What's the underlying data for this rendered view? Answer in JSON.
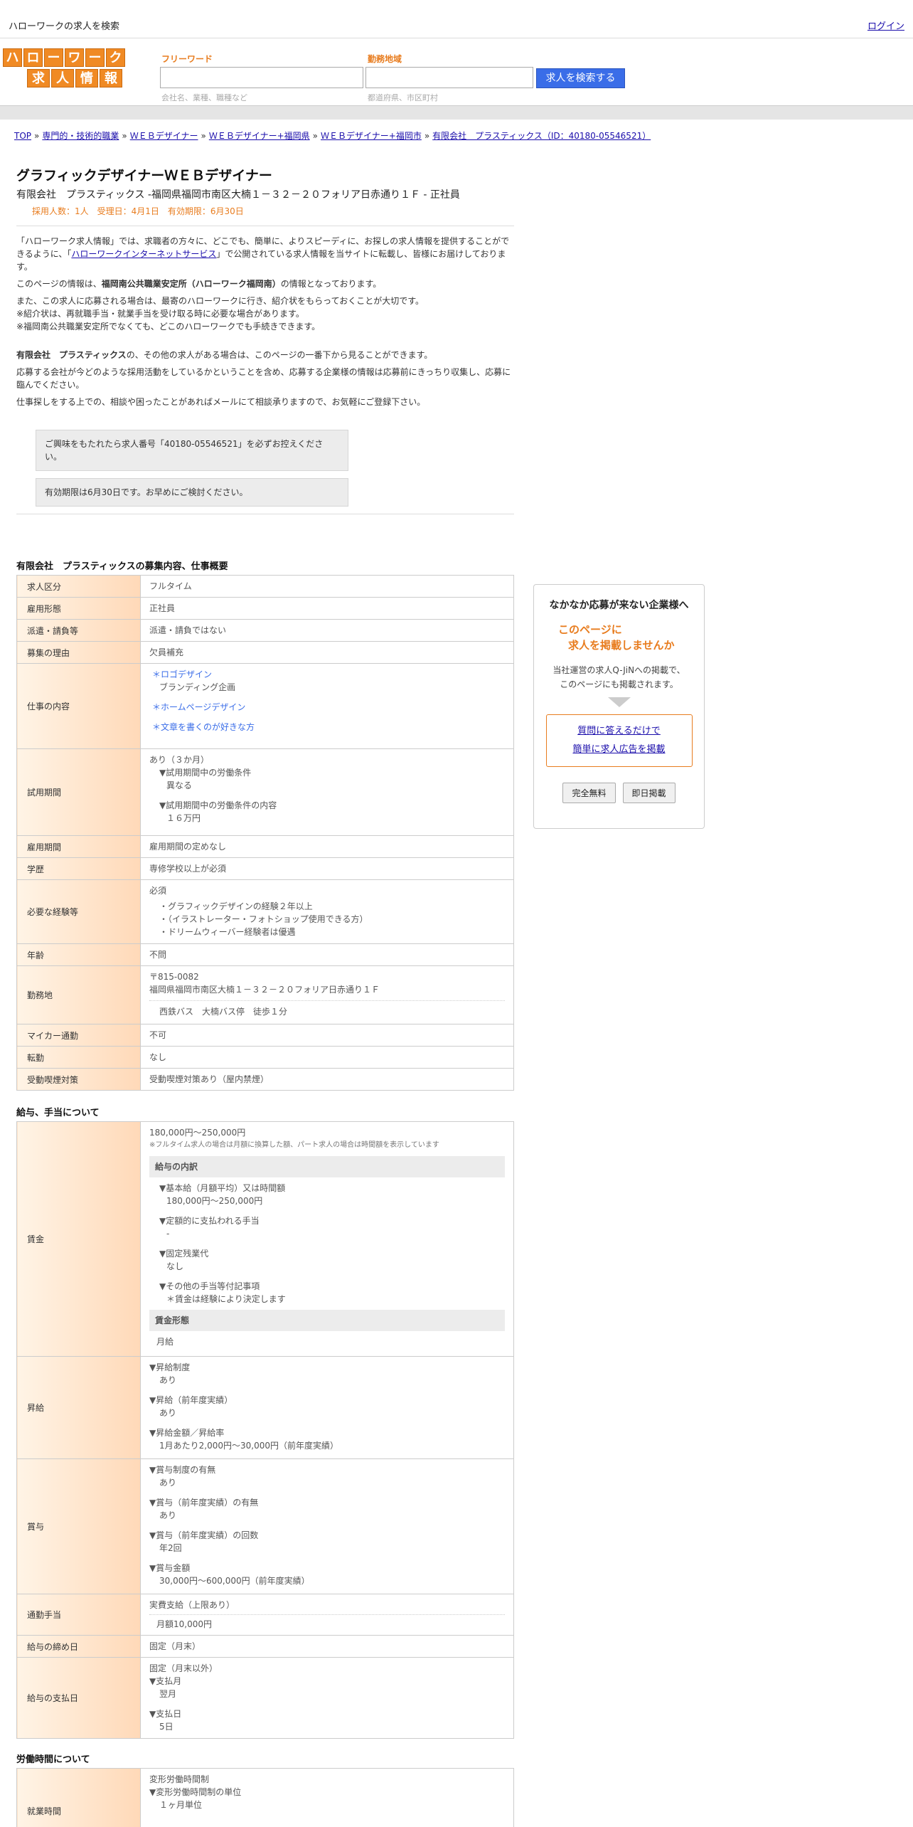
{
  "topbar": {
    "site_title": "ハローワークの求人を検索",
    "login": "ログイン"
  },
  "logo": {
    "row1": [
      "ハ",
      "ロ",
      "ー",
      "ワ",
      "ー",
      "ク"
    ],
    "row2": [
      "求",
      "人",
      "情",
      "報"
    ]
  },
  "search": {
    "keyword_label": "フリーワード",
    "keyword_hint": "会社名、業種、職種など",
    "area_label": "勤務地域",
    "area_hint": "都道府県、市区町村",
    "button": "人を検索する"
  },
  "breadcrumb": [
    "TOP",
    "専門的・技術的職業",
    "ＷＥＢデザイナー",
    "ＷＥＢデザイナー+福岡県",
    "ＷＥＢデザイナー+福岡市",
    "有限会社　プラスティックス（ID：40180-05546521）"
  ],
  "job": {
    "title": "グラフィックデザイナーＷＥＢデザイナー",
    "company_line": "有限会社　プラスティックス -福岡県福岡市南区大楠１－３２－２０フォリア日赤通り１Ｆ - 正社員",
    "meta": "採用人数：1人　受理日：4月1日　有効期限：6月30日"
  },
  "intro": {
    "p1a": "「ハローワーク求人情報」では、求職者の方々に、どこでも、簡単に、よりスピーディに、お探しの求人情報を提供することができるように、「",
    "p1link": "ハローワークインターネットサービス",
    "p1b": "」で公開されている求人情報を当サイトに転載し、皆様にお届けしております。",
    "p2a": "このページの情報は、",
    "p2b": "福岡南公共職業安定所（ハローワーク福岡南）",
    "p2c": "の情報となっております。",
    "p3": "また、この求人に応募される場合は、最寄のハローワークに行き、紹介状をもらっておくことが大切です。",
    "p4": "※紹介状は、再就職手当・就業手当を受け取る時に必要な場合があります。",
    "p5": "※福岡南公共職業安定所でなくても、どこのハローワークでも手続きできます。",
    "p6a": "有限会社　プラスティックス",
    "p6b": "の、その他の求人がある場合は、このページの一番下から見ることができます。",
    "p7": "応募する会社が今どのような採用活動をしているかということを含め、応募する企業様の情報は応募前にきっちり収集し、応募に臨んでください。",
    "p8": "仕事探しをする上での、相談や困ったことがあればメールにて相談承りますので、お気軽にご登録下さい。",
    "notice1": "ご興味をもたれたら求人番号「40180-05546521」を必ずお控えください。",
    "notice2": "有効期限は6月30日です。お早めにご検討ください。"
  },
  "summary": {
    "title": "有限会社　プラスティックスの募集内容、仕事概要",
    "rows": {
      "kubun": [
        "求人区分",
        "フルタイム"
      ],
      "keitai": [
        "雇用形態",
        "正社員"
      ],
      "haken": [
        "派遣・請負等",
        "派遣・請負ではない"
      ],
      "riyu": [
        "募集の理由",
        "欠員補充"
      ],
      "naiyo": [
        "仕事の内容",
        "＊ロゴデザイン",
        "ブランディング企画",
        "＊ホームページデザイン",
        "＊文章を書くのが好きな方"
      ],
      "shiyo": [
        "試用期間",
        "あり（３か月）",
        "▼試用期間中の労働条件",
        "異なる",
        "▼試用期間中の労働条件の内容",
        "１６万円"
      ],
      "kikan": [
        "雇用期間",
        "雇用期間の定めなし"
      ],
      "gakureki": [
        "学歴",
        "専修学校以上が必須"
      ],
      "keiken": [
        "必要な経験等",
        "必須",
        "・グラフィックデザインの経験２年以上",
        "・（イラストレーター・フォトショップ使用できる方）",
        "・ドリームウィーバー経験者は優遇"
      ],
      "nenrei": [
        "年齢",
        "不問"
      ],
      "kinmuchi": [
        "勤務地",
        "〒815-0082",
        "福岡県福岡市南区大楠１－３２－２０フォリア日赤通り１Ｆ",
        "西鉄バス　大楠バス停　徒歩１分"
      ],
      "mycar": [
        "マイカー通勤",
        "不可"
      ],
      "tenkin": [
        "転勤",
        "なし"
      ],
      "kitsuen": [
        "受動喫煙対策",
        "受動喫煙対策あり（屋内禁煙）"
      ]
    }
  },
  "salary": {
    "title": "給与、手当について",
    "chingin_label": "賃金",
    "range": "180,000円〜250,000円",
    "note": "※フルタイム求人の場合は月額に換算した額、パート求人の場合は時間額を表示しています",
    "breakdown_head": "給与の内訳",
    "b1a": "▼基本給（月額平均）又は時間額",
    "b1b": "180,000円〜250,000円",
    "b2a": "▼定額的に支払われる手当",
    "b2b": "-",
    "b3a": "▼固定残業代",
    "b3b": "なし",
    "b4a": "▼その他の手当等付記事項",
    "b4b": "＊賃金は経験により決定します",
    "form_head": "賃金形態",
    "form_val": "月給",
    "shokyu_label": "昇給",
    "s1a": "▼昇給制度",
    "s1b": "あり",
    "s2a": "▼昇給（前年度実績）",
    "s2b": "あり",
    "s3a": "▼昇給金額／昇給率",
    "s3b": "1月あたり2,000円〜30,000円（前年度実績）",
    "shoyo_label": "賞与",
    "y1a": "▼賞与制度の有無",
    "y1b": "あり",
    "y2a": "▼賞与（前年度実績）の有無",
    "y2b": "あり",
    "y3a": "▼賞与（前年度実績）の回数",
    "y3b": "年2回",
    "y4a": "▼賞与金額",
    "y4b": "30,000円〜600,000円（前年度実績）",
    "tsukin_label": "通勤手当",
    "tsukin_a": "実費支給（上限あり）",
    "tsukin_b": "月額10,000円",
    "shime_label": "給与の締め日",
    "shime_val": "固定（月末）",
    "shiharai_label": "給与の支払日",
    "p1": "固定（月末以外）",
    "p2a": "▼支払月",
    "p2b": "翌月",
    "p3a": "▼支払日",
    "p3b": "5日"
  },
  "hours": {
    "title": "労働時間について",
    "label": "就業時間",
    "l1": "変形労働時間制",
    "l2": "▼変形労働時間制の単位",
    "l3": "１ヶ月単位"
  },
  "side": {
    "t1": "なかなか応募が来ない企業様へ",
    "t2a": "このページに",
    "t2b": "求人を掲載しませんか",
    "t3a": "当社運営の求人Q-JiNへの掲載で、",
    "t3b": "このページにも掲載されます。",
    "link1": "質問に答えるだけで",
    "link2": "簡単に求人広告を掲載",
    "btn1": "完全無料",
    "btn2": "即日掲載"
  }
}
